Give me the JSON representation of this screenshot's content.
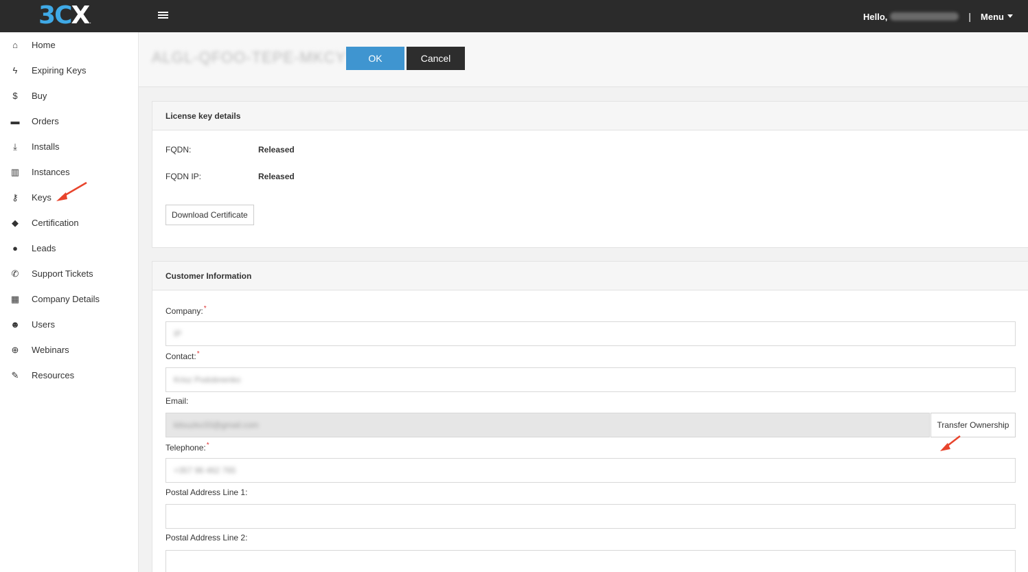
{
  "brand": {
    "logo_3": "3",
    "logo_c": "C",
    "logo_x": "X",
    "logo_dot": ".",
    "accent_color": "#3fa9e6"
  },
  "topbar": {
    "hello": "Hello,",
    "separator": "|",
    "menu": "Menu",
    "user_name_redacted": true
  },
  "sidebar": {
    "items": [
      {
        "icon": "home-icon",
        "glyph": "⌂",
        "label": "Home"
      },
      {
        "icon": "bolt-icon",
        "glyph": "ϟ",
        "label": "Expiring Keys"
      },
      {
        "icon": "dollar-icon",
        "glyph": "$",
        "label": "Buy"
      },
      {
        "icon": "briefcase-icon",
        "glyph": "▬",
        "label": "Orders"
      },
      {
        "icon": "download-icon",
        "glyph": "⤓",
        "label": "Installs"
      },
      {
        "icon": "bar-chart-icon",
        "glyph": "▥",
        "label": "Instances"
      },
      {
        "icon": "key-icon",
        "glyph": "⚷",
        "label": "Keys"
      },
      {
        "icon": "graduation-cap-icon",
        "glyph": "◆",
        "label": "Certification"
      },
      {
        "icon": "user-icon",
        "glyph": "●",
        "label": "Leads"
      },
      {
        "icon": "phone-icon",
        "glyph": "✆",
        "label": "Support Tickets"
      },
      {
        "icon": "building-icon",
        "glyph": "▦",
        "label": "Company Details"
      },
      {
        "icon": "users-icon",
        "glyph": "☻",
        "label": "Users"
      },
      {
        "icon": "globe-icon",
        "glyph": "⊕",
        "label": "Webinars"
      },
      {
        "icon": "pencil-icon",
        "glyph": "✎",
        "label": "Resources"
      }
    ]
  },
  "header": {
    "key_title": "ALGL-QFOO-TEPE-MKCY",
    "ok_label": "OK",
    "cancel_label": "Cancel"
  },
  "license": {
    "title": "License key details",
    "fqdn_label": "FQDN:",
    "fqdn_value": "Released",
    "fqdn_ip_label": "FQDN IP:",
    "fqdn_ip_value": "Released",
    "download_label": "Download Certificate"
  },
  "customer": {
    "title": "Customer Information",
    "company_label": "Company:",
    "company_value": "IP",
    "contact_label": "Contact:",
    "contact_value": "Krisz Podobnenko",
    "email_label": "Email:",
    "email_value": "kitsuzko33@gmail.com",
    "transfer_label": "Transfer Ownership",
    "telephone_label": "Telephone:",
    "telephone_value": "+357 96 462 765",
    "postal1_label": "Postal Address Line 1:",
    "postal1_value": "",
    "postal2_label": "Postal Address Line 2:",
    "postal2_value": "",
    "required_mark": "*"
  },
  "colors": {
    "topbar_bg": "#2b2b2b",
    "ok_button": "#3f95d0",
    "cancel_button": "#2d2d2d",
    "annotation_arrow": "#e8442c"
  }
}
